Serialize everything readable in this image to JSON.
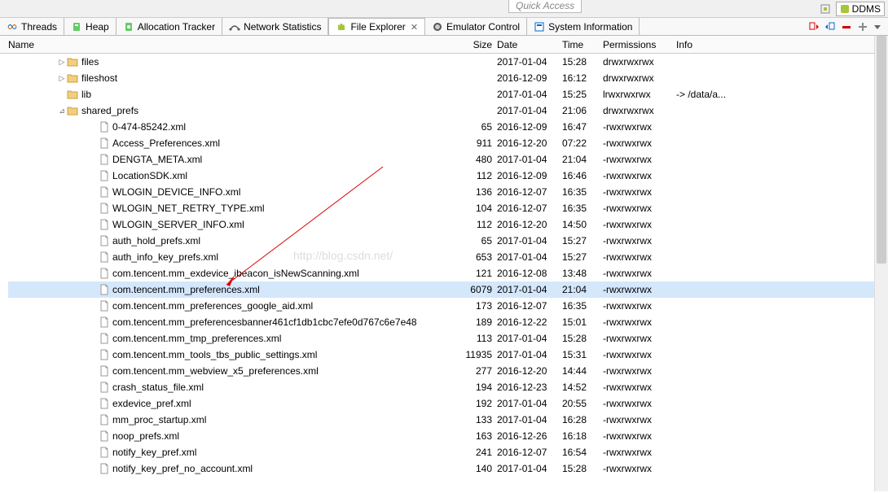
{
  "top_toolbar": {
    "quick_access_placeholder": "Quick Access",
    "ddms_label": "DDMS"
  },
  "tabs": [
    {
      "icon": "threads",
      "label": "Threads"
    },
    {
      "icon": "heap",
      "label": "Heap"
    },
    {
      "icon": "allocation",
      "label": "Allocation Tracker"
    },
    {
      "icon": "network",
      "label": "Network Statistics"
    },
    {
      "icon": "android",
      "label": "File Explorer",
      "active": true,
      "closeable": true
    },
    {
      "icon": "emulator",
      "label": "Emulator Control"
    },
    {
      "icon": "sysinfo",
      "label": "System Information"
    }
  ],
  "columns": {
    "name": "Name",
    "size": "Size",
    "date": "Date",
    "time": "Time",
    "permissions": "Permissions",
    "info": "Info"
  },
  "rows": [
    {
      "depth": 3,
      "type": "folder",
      "expand": "▷",
      "name": "files",
      "size": "",
      "date": "2017-01-04",
      "time": "15:28",
      "perm": "drwxrwxrwx",
      "info": ""
    },
    {
      "depth": 3,
      "type": "folder",
      "expand": "▷",
      "name": "fileshost",
      "size": "",
      "date": "2016-12-09",
      "time": "16:12",
      "perm": "drwxrwxrwx",
      "info": ""
    },
    {
      "depth": 3,
      "type": "folder",
      "expand": "",
      "name": "lib",
      "size": "",
      "date": "2017-01-04",
      "time": "15:25",
      "perm": "lrwxrwxrwx",
      "info": "-> /data/a..."
    },
    {
      "depth": 3,
      "type": "folder",
      "expand": "⊿",
      "name": "shared_prefs",
      "size": "",
      "date": "2017-01-04",
      "time": "21:06",
      "perm": "drwxrwxrwx",
      "info": ""
    },
    {
      "depth": 5,
      "type": "file",
      "expand": "",
      "name": "0-474-85242.xml",
      "size": "65",
      "date": "2016-12-09",
      "time": "16:47",
      "perm": "-rwxrwxrwx",
      "info": ""
    },
    {
      "depth": 5,
      "type": "file",
      "expand": "",
      "name": "Access_Preferences.xml",
      "size": "911",
      "date": "2016-12-20",
      "time": "07:22",
      "perm": "-rwxrwxrwx",
      "info": ""
    },
    {
      "depth": 5,
      "type": "file",
      "expand": "",
      "name": "DENGTA_META.xml",
      "size": "480",
      "date": "2017-01-04",
      "time": "21:04",
      "perm": "-rwxrwxrwx",
      "info": ""
    },
    {
      "depth": 5,
      "type": "file",
      "expand": "",
      "name": "LocationSDK.xml",
      "size": "112",
      "date": "2016-12-09",
      "time": "16:46",
      "perm": "-rwxrwxrwx",
      "info": ""
    },
    {
      "depth": 5,
      "type": "file",
      "expand": "",
      "name": "WLOGIN_DEVICE_INFO.xml",
      "size": "136",
      "date": "2016-12-07",
      "time": "16:35",
      "perm": "-rwxrwxrwx",
      "info": ""
    },
    {
      "depth": 5,
      "type": "file",
      "expand": "",
      "name": "WLOGIN_NET_RETRY_TYPE.xml",
      "size": "104",
      "date": "2016-12-07",
      "time": "16:35",
      "perm": "-rwxrwxrwx",
      "info": ""
    },
    {
      "depth": 5,
      "type": "file",
      "expand": "",
      "name": "WLOGIN_SERVER_INFO.xml",
      "size": "112",
      "date": "2016-12-20",
      "time": "14:50",
      "perm": "-rwxrwxrwx",
      "info": ""
    },
    {
      "depth": 5,
      "type": "file",
      "expand": "",
      "name": "auth_hold_prefs.xml",
      "size": "65",
      "date": "2017-01-04",
      "time": "15:27",
      "perm": "-rwxrwxrwx",
      "info": ""
    },
    {
      "depth": 5,
      "type": "file",
      "expand": "",
      "name": "auth_info_key_prefs.xml",
      "size": "653",
      "date": "2017-01-04",
      "time": "15:27",
      "perm": "-rwxrwxrwx",
      "info": ""
    },
    {
      "depth": 5,
      "type": "file",
      "expand": "",
      "name": "com.tencent.mm_exdevice_ibeacon_isNewScanning.xml",
      "size": "121",
      "date": "2016-12-08",
      "time": "13:48",
      "perm": "-rwxrwxrwx",
      "info": ""
    },
    {
      "depth": 5,
      "type": "file",
      "expand": "",
      "name": "com.tencent.mm_preferences.xml",
      "size": "6079",
      "date": "2017-01-04",
      "time": "21:04",
      "perm": "-rwxrwxrwx",
      "info": "",
      "selected": true
    },
    {
      "depth": 5,
      "type": "file",
      "expand": "",
      "name": "com.tencent.mm_preferences_google_aid.xml",
      "size": "173",
      "date": "2016-12-07",
      "time": "16:35",
      "perm": "-rwxrwxrwx",
      "info": ""
    },
    {
      "depth": 5,
      "type": "file",
      "expand": "",
      "name": "com.tencent.mm_preferencesbanner461cf1db1cbc7efe0d767c6e7e48",
      "size": "189",
      "date": "2016-12-22",
      "time": "15:01",
      "perm": "-rwxrwxrwx",
      "info": ""
    },
    {
      "depth": 5,
      "type": "file",
      "expand": "",
      "name": "com.tencent.mm_tmp_preferences.xml",
      "size": "113",
      "date": "2017-01-04",
      "time": "15:28",
      "perm": "-rwxrwxrwx",
      "info": ""
    },
    {
      "depth": 5,
      "type": "file",
      "expand": "",
      "name": "com.tencent.mm_tools_tbs_public_settings.xml",
      "size": "11935",
      "date": "2017-01-04",
      "time": "15:31",
      "perm": "-rwxrwxrwx",
      "info": ""
    },
    {
      "depth": 5,
      "type": "file",
      "expand": "",
      "name": "com.tencent.mm_webview_x5_preferences.xml",
      "size": "277",
      "date": "2016-12-20",
      "time": "14:44",
      "perm": "-rwxrwxrwx",
      "info": ""
    },
    {
      "depth": 5,
      "type": "file",
      "expand": "",
      "name": "crash_status_file.xml",
      "size": "194",
      "date": "2016-12-23",
      "time": "14:52",
      "perm": "-rwxrwxrwx",
      "info": ""
    },
    {
      "depth": 5,
      "type": "file",
      "expand": "",
      "name": "exdevice_pref.xml",
      "size": "192",
      "date": "2017-01-04",
      "time": "20:55",
      "perm": "-rwxrwxrwx",
      "info": ""
    },
    {
      "depth": 5,
      "type": "file",
      "expand": "",
      "name": "mm_proc_startup.xml",
      "size": "133",
      "date": "2017-01-04",
      "time": "16:28",
      "perm": "-rwxrwxrwx",
      "info": ""
    },
    {
      "depth": 5,
      "type": "file",
      "expand": "",
      "name": "noop_prefs.xml",
      "size": "163",
      "date": "2016-12-26",
      "time": "16:18",
      "perm": "-rwxrwxrwx",
      "info": ""
    },
    {
      "depth": 5,
      "type": "file",
      "expand": "",
      "name": "notify_key_pref.xml",
      "size": "241",
      "date": "2016-12-07",
      "time": "16:54",
      "perm": "-rwxrwxrwx",
      "info": ""
    },
    {
      "depth": 5,
      "type": "file",
      "expand": "",
      "name": "notify_key_pref_no_account.xml",
      "size": "140",
      "date": "2017-01-04",
      "time": "15:28",
      "perm": "-rwxrwxrwx",
      "info": ""
    }
  ],
  "watermark": "http://blog.csdn.net/"
}
